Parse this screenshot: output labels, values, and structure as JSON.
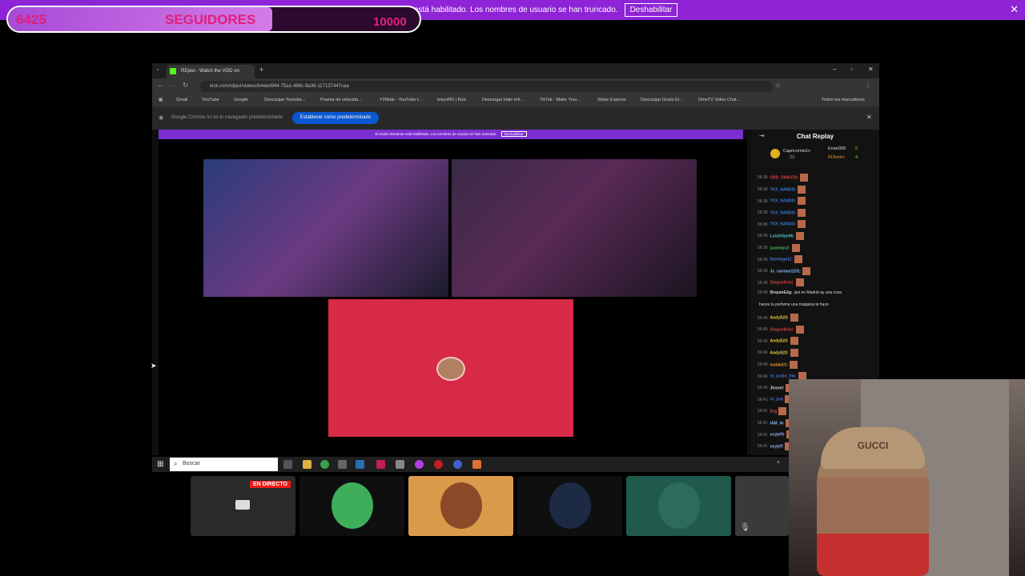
{
  "banner": {
    "message": "El modo Streamer está habilitado. Los nombres de usuario se han truncado.",
    "button": "Deshabilitar",
    "close": "✕"
  },
  "goal": {
    "count": "6425",
    "label": "SEGUIDORES",
    "target": "10000",
    "progress": 0.6425
  },
  "browser": {
    "tab_title": "RDjavi - Watch the VOD on",
    "url": "kick.com/rdjavi/videos/b4eed944-75a1-468c-9a36-117137447caa",
    "bookmarks": [
      "Gmail",
      "YouTube",
      "Google",
      "Descargar Youtube...",
      "Prueba de velocida...",
      "Y2Mate - YouTube t...",
      "tokyoRD | Kick",
      "Descargar Halo Infi...",
      "TikTok - Make Your...",
      "Stripe Express",
      "Descargar Gratis El...",
      "OmeTV Video Chat..."
    ],
    "all_bookmarks": "Todos los marcadores",
    "infobar_text": "Google Chrome no es tu navegador predeterminado",
    "infobar_button": "Establecer como predeterminado",
    "kick_banner": "El modo Streamer está habilitado. Los nombres de usuario se han truncado.",
    "kick_banner_btn": "Deshabilitar"
  },
  "chat": {
    "title": "Chat Replay",
    "pinned": [
      {
        "name": "Capricornio1v",
        "count": "23"
      },
      {
        "name": "Enan058",
        "count": "5"
      },
      {
        "name": "RDkinito",
        "count": "4"
      }
    ],
    "messages": [
      {
        "time": "56:38",
        "user": "CRD_PANOTA:",
        "color": "#e04040",
        "text": ""
      },
      {
        "time": "56:38",
        "user": "TKX_NANDO:",
        "color": "#3a7bd5",
        "text": ""
      },
      {
        "time": "56:38",
        "user": "TKX_NANDO:",
        "color": "#3a7bd5",
        "text": ""
      },
      {
        "time": "56:38",
        "user": "TKX_NANDO:",
        "color": "#3a7bd5",
        "text": ""
      },
      {
        "time": "56:38",
        "user": "TKX_NANDO:",
        "color": "#3a7bd5",
        "text": ""
      },
      {
        "time": "56:38",
        "user": "Luisfelipe06:",
        "color": "#52c0d0",
        "text": ""
      },
      {
        "time": "56:39",
        "user": "juanmpx2:",
        "color": "#3fae5a",
        "text": ""
      },
      {
        "time": "56:39",
        "user": "Domingo11:",
        "color": "#4a72d0",
        "text": ""
      },
      {
        "time": "56:39",
        "user": "Js_carman1201:",
        "color": "#8ab4f8",
        "text": ""
      },
      {
        "time": "56:39",
        "user": "Dieguoficial:",
        "color": "#d04040",
        "text": ""
      },
      {
        "time": "56:40",
        "user": "BrayanEdg:",
        "color": "#d0d0d0",
        "text": "javi en Madrid ay una cosa"
      },
      {
        "time": "",
        "user": "",
        "color": "#d0d0d0",
        "text": "haces tu perfume una maquina te hace"
      },
      {
        "time": "56:40",
        "user": "AndyS23:",
        "color": "#f0d040",
        "text": ""
      },
      {
        "time": "56:40",
        "user": "Dieguoficial:",
        "color": "#d04040",
        "text": ""
      },
      {
        "time": "56:40",
        "user": "AndyS23:",
        "color": "#f0d040",
        "text": ""
      },
      {
        "time": "56:40",
        "user": "AndyS23:",
        "color": "#f0d040",
        "text": ""
      },
      {
        "time": "56:40",
        "user": "malala01:",
        "color": "#e09030",
        "text": ""
      },
      {
        "time": "56:40",
        "user": "rd_jostin_tita:",
        "color": "#4a72d0",
        "text": ""
      },
      {
        "time": "56:40",
        "user": "Jhonel:",
        "color": "#d0d0d0",
        "text": ""
      },
      {
        "time": "56:41",
        "user": "rd_jost",
        "color": "#4a72d0",
        "text": ""
      },
      {
        "time": "56:41",
        "user": "ling",
        "color": "#d04040",
        "text": ""
      },
      {
        "time": "56:41",
        "user": "IAM_Ar",
        "color": "#8ab4f8",
        "text": ""
      },
      {
        "time": "56:41",
        "user": "soyjeffr",
        "color": "#8ab4f8",
        "text": ""
      },
      {
        "time": "56:41",
        "user": "soyjeff",
        "color": "#8ab4f8",
        "text": ""
      }
    ]
  },
  "taskbar": {
    "search": "Buscar"
  },
  "participants": {
    "live_badge": "EN DIRECTO",
    "tile_colors": [
      "#2a2a2a",
      "#0f0f0f",
      "#d99b49",
      "#0f0f0f",
      "#1f5a4c",
      "#3a3a3a"
    ]
  },
  "webcam": {
    "cap_text": "GUCCI"
  }
}
